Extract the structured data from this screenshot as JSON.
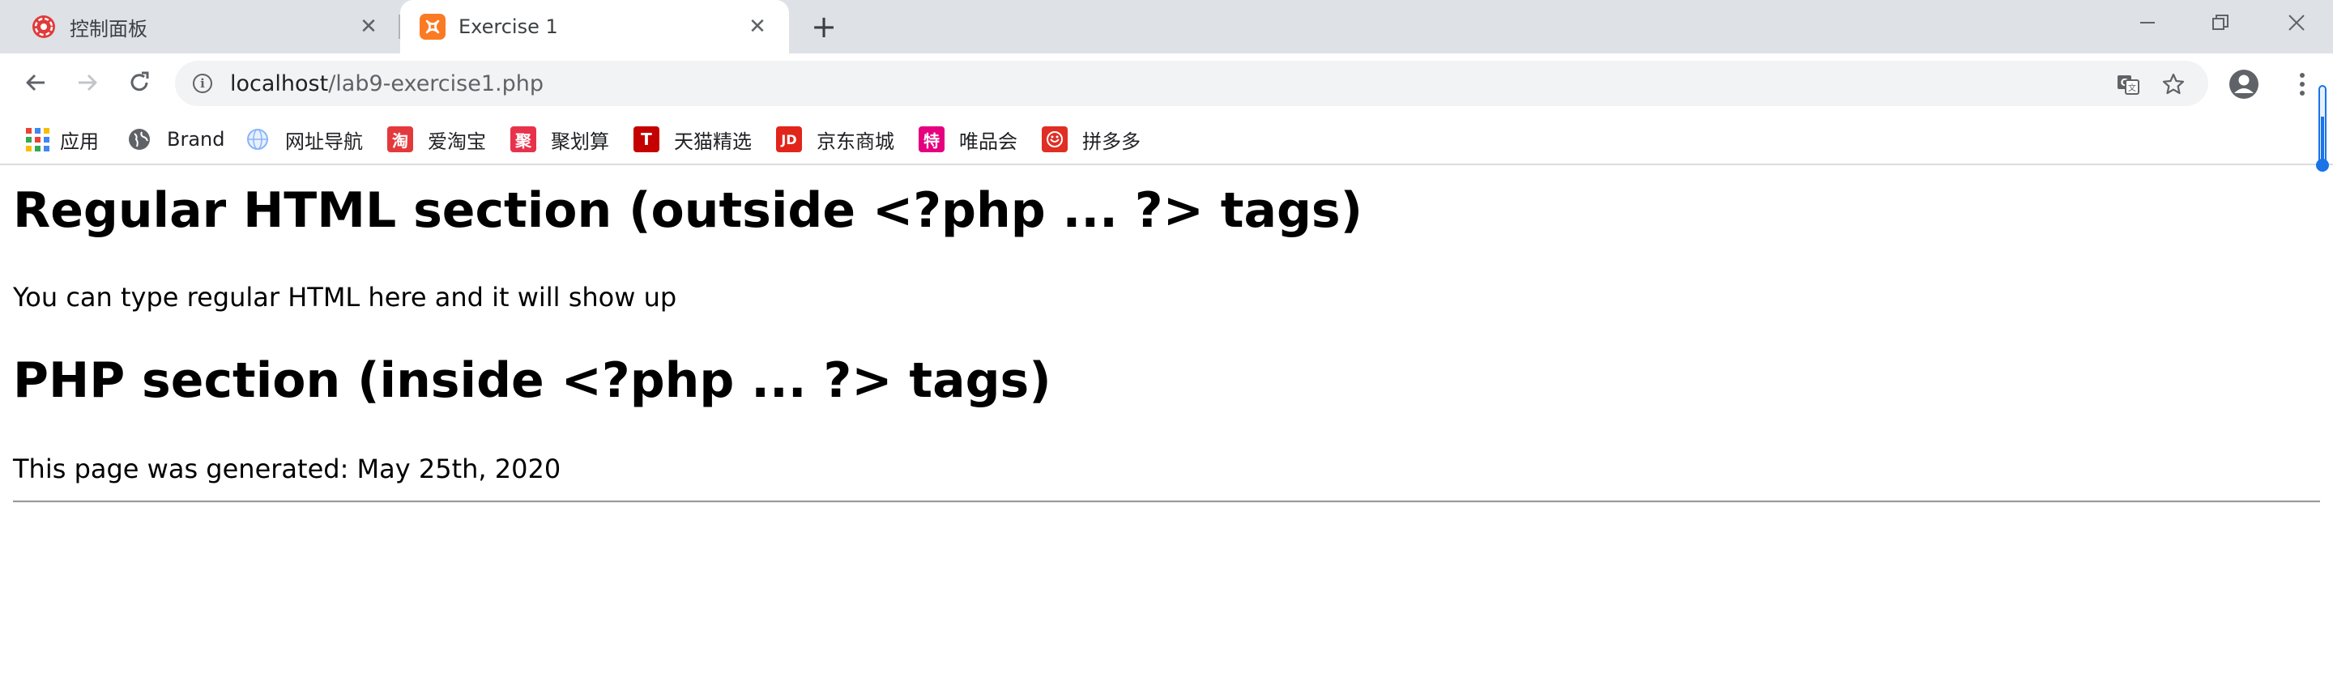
{
  "tabs": [
    {
      "title": "控制面板",
      "close": "✕"
    },
    {
      "title": "Exercise 1",
      "close": "✕"
    }
  ],
  "new_tab": "+",
  "omnibox": {
    "host": "localhost",
    "path": "/lab9-exercise1.php"
  },
  "bookmarks": [
    {
      "label": "应用",
      "icon": "apps-grid-icon"
    },
    {
      "label": "Brand",
      "icon": "globe-dark-icon"
    },
    {
      "label": "网址导航",
      "icon": "globe-light-icon"
    },
    {
      "label": "爱淘宝",
      "icon": "taobao-icon",
      "glyph": "淘",
      "color": "#e4393c"
    },
    {
      "label": "聚划算",
      "icon": "juhuasuan-icon",
      "glyph": "聚",
      "color": "#e8324b"
    },
    {
      "label": "天猫精选",
      "icon": "tmall-icon",
      "glyph": "T",
      "color": "#c40000"
    },
    {
      "label": "京东商城",
      "icon": "jd-icon",
      "glyph": "JD",
      "color": "#e1251b"
    },
    {
      "label": "唯品会",
      "icon": "vip-icon",
      "glyph": "特",
      "color": "#e4007f"
    },
    {
      "label": "拼多多",
      "icon": "pinduoduo-icon",
      "color": "#e02e24"
    }
  ],
  "page": {
    "heading1": "Regular HTML section (outside <?php ... ?> tags)",
    "paragraph1": "You can type regular HTML here and it will show up",
    "heading2": "PHP section (inside <?php ... ?> tags)",
    "paragraph2": "This page was generated: May 25th, 2020"
  },
  "colors": {
    "tabstrip": "#dee1e6",
    "omnibox": "#f1f3f4",
    "accent_blue": "#1a73e8",
    "xampp_orange": "#fb7a24"
  }
}
